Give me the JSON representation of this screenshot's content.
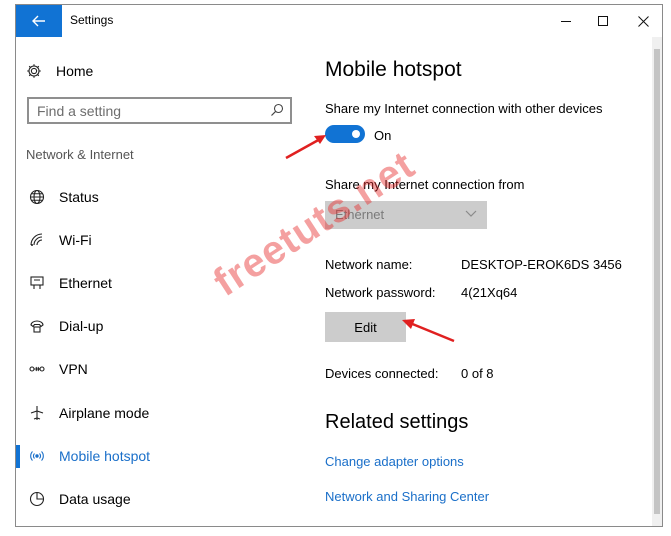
{
  "titlebar": {
    "title": "Settings",
    "back_icon": "back-arrow-icon",
    "minimize_label": "—",
    "maximize_icon": "maximize-icon",
    "close_label": "✕",
    "accent_color": "#1173d4"
  },
  "sidebar": {
    "home_label": "Home",
    "search_placeholder": "Find a setting",
    "section_label": "Network & Internet",
    "items": [
      {
        "label": "Status",
        "icon": "globe-icon"
      },
      {
        "label": "Wi-Fi",
        "icon": "wifi-icon"
      },
      {
        "label": "Ethernet",
        "icon": "ethernet-icon"
      },
      {
        "label": "Dial-up",
        "icon": "dialup-icon"
      },
      {
        "label": "VPN",
        "icon": "vpn-icon"
      },
      {
        "label": "Airplane mode",
        "icon": "airplane-icon"
      },
      {
        "label": "Mobile hotspot",
        "icon": "hotspot-icon",
        "active": true
      },
      {
        "label": "Data usage",
        "icon": "data-usage-icon"
      }
    ]
  },
  "main": {
    "title": "Mobile hotspot",
    "share_label": "Share my Internet connection with other devices",
    "toggle_state": "On",
    "share_from_label": "Share my Internet connection from",
    "share_from_value": "Ethernet",
    "network_name_label": "Network name:",
    "network_name_value": "DESKTOP-EROK6DS 3456",
    "network_password_label": "Network password:",
    "network_password_value": "4(21Xq64",
    "edit_label": "Edit",
    "devices_label": "Devices connected:",
    "devices_value": "0 of 8",
    "related_title": "Related settings",
    "links": [
      "Change adapter options",
      "Network and Sharing Center"
    ]
  },
  "watermark": "freetuts.net"
}
